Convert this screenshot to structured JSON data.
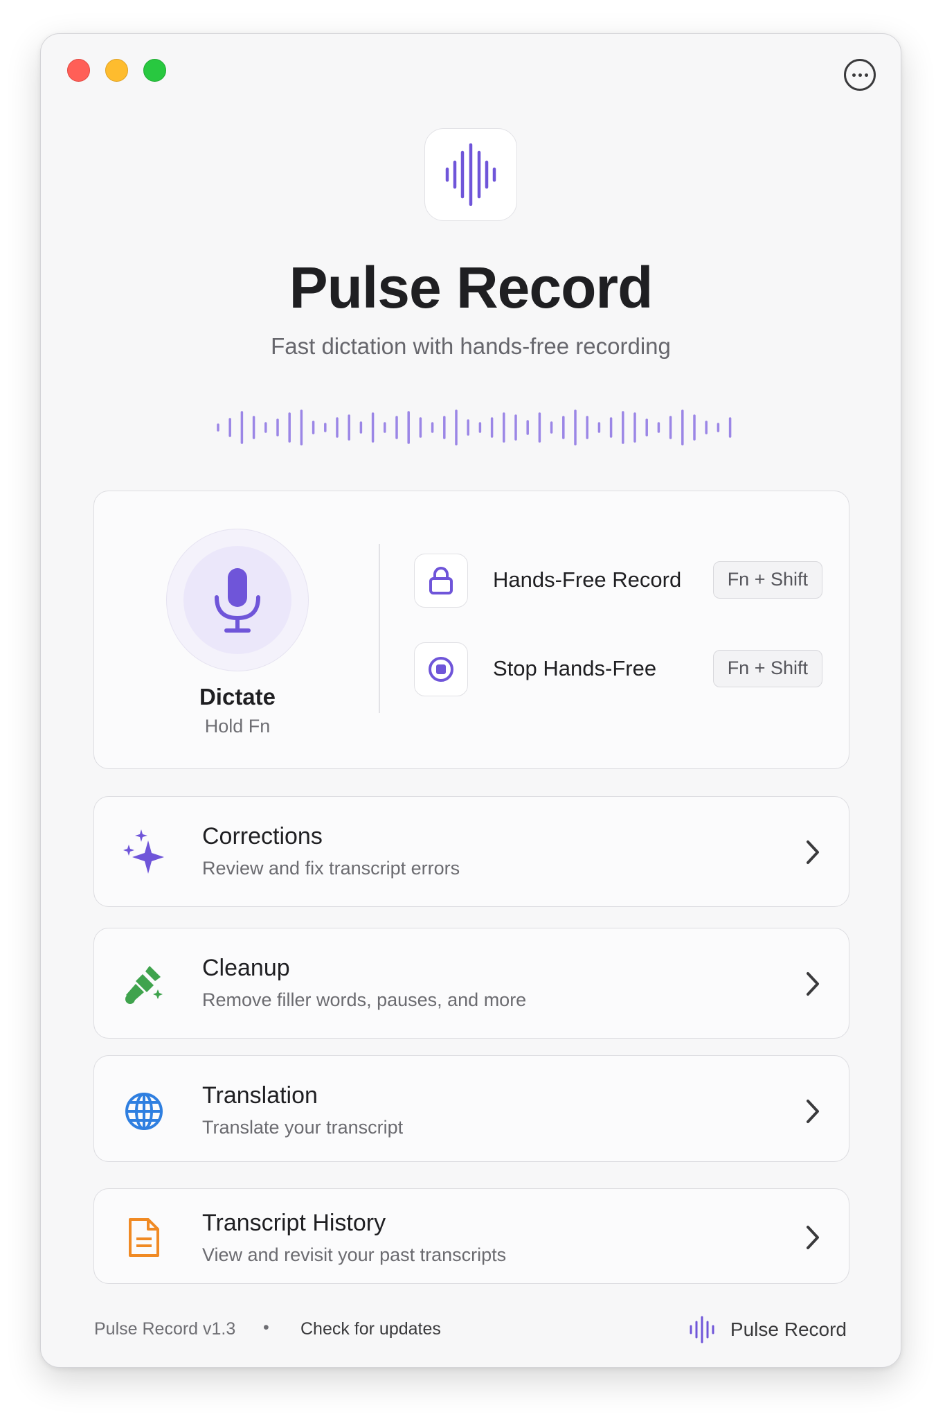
{
  "app": {
    "title": "Pulse Record",
    "subtitle": "Fast dictation with hands-free recording"
  },
  "colors": {
    "accent": "#6f55d9",
    "corrections": "#6f55d9",
    "cleanup": "#3fa34d",
    "translation": "#2f7fe0",
    "history": "#f08a24"
  },
  "dictate": {
    "label": "Dictate",
    "hint": "Hold Fn",
    "icon": "microphone-icon"
  },
  "actions": [
    {
      "label": "Hands-Free Record",
      "shortcut": "Fn + Shift",
      "icon": "lock-icon"
    },
    {
      "label": "Stop Hands-Free",
      "shortcut": "Fn + Shift",
      "icon": "stop-icon"
    }
  ],
  "features": [
    {
      "title": "Corrections",
      "description": "Review and fix transcript errors",
      "icon": "sparkles-icon"
    },
    {
      "title": "Cleanup",
      "description": "Remove filler words, pauses, and more",
      "icon": "broom-icon"
    },
    {
      "title": "Translation",
      "description": "Translate your transcript",
      "icon": "globe-icon"
    },
    {
      "title": "Transcript History",
      "description": "View and revisit your past transcripts",
      "icon": "document-icon"
    }
  ],
  "footer": {
    "version": "Pulse Record v1.3",
    "separator": "•",
    "update_link": "Check for updates",
    "brand": "Pulse Record"
  }
}
